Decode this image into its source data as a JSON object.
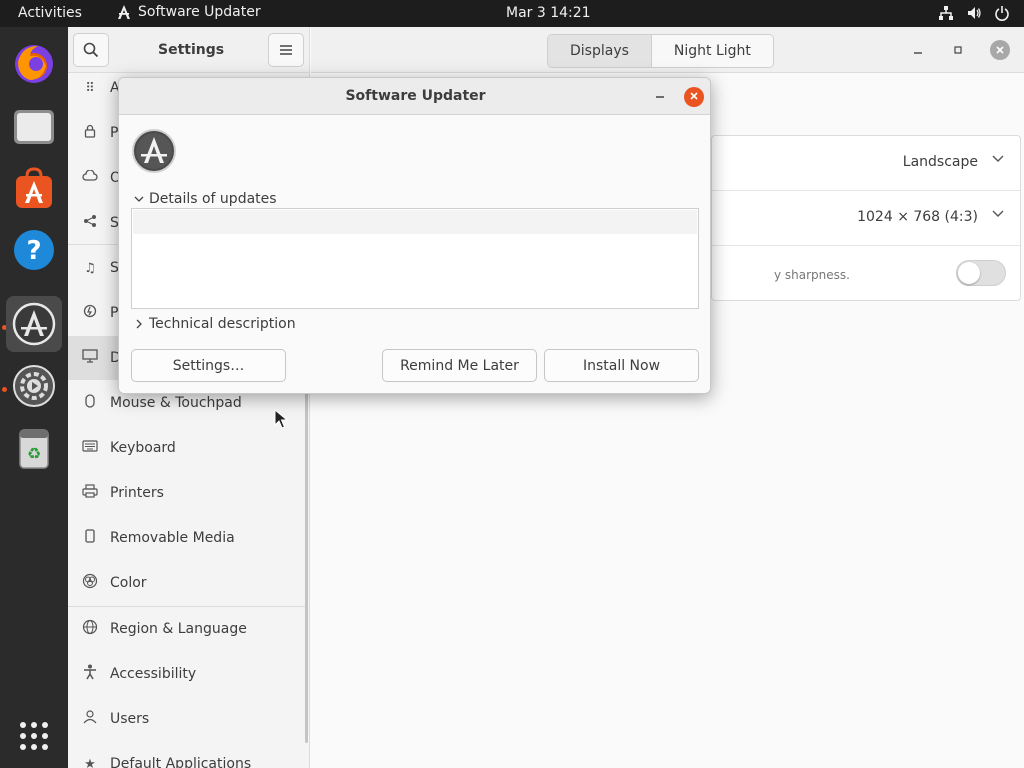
{
  "topbar": {
    "activities": "Activities",
    "app_name": "Software Updater",
    "clock": "Mar 3  14:21"
  },
  "dock": {
    "items": [
      "firefox-icon",
      "files-icon",
      "app-center-icon",
      "help-icon",
      "software-updater-icon",
      "settings-icon",
      "trash-icon",
      "show-apps-icon"
    ]
  },
  "settings": {
    "title": "Settings",
    "tabs": [
      "Displays",
      "Night Light"
    ],
    "active_tab": "Displays",
    "sidebar": [
      {
        "label": "A",
        "icon": "grid-icon"
      },
      {
        "label": "P",
        "icon": "lock-icon"
      },
      {
        "label": "O",
        "icon": "cloud-icon"
      },
      {
        "label": "S",
        "icon": "share-icon"
      },
      {
        "label": "S",
        "icon": "music-icon"
      },
      {
        "label": "P",
        "icon": "power-icon"
      },
      {
        "label": "D",
        "icon": "display-icon"
      },
      {
        "label": "Mouse & Touchpad",
        "icon": "mouse-icon"
      },
      {
        "label": "Keyboard",
        "icon": "keyboard-icon"
      },
      {
        "label": "Printers",
        "icon": "printer-icon"
      },
      {
        "label": "Removable Media",
        "icon": "media-icon"
      },
      {
        "label": "Color",
        "icon": "color-icon"
      },
      {
        "label": "Region & Language",
        "icon": "globe-icon"
      },
      {
        "label": "Accessibility",
        "icon": "accessibility-icon"
      },
      {
        "label": "Users",
        "icon": "user-icon"
      },
      {
        "label": "Default Applications",
        "icon": "star-icon"
      }
    ],
    "display_panel": {
      "orientation": "Landscape",
      "resolution": "1024 × 768 (4:3)",
      "fractional_hint": "y sharpness."
    }
  },
  "dialog": {
    "title": "Software Updater",
    "details_label": "Details of updates",
    "technical_label": "Technical description",
    "settings_button": "Settings…",
    "remind_button": "Remind Me Later",
    "install_button": "Install Now"
  },
  "colors": {
    "accent": "#e95420",
    "topbar": "#1d1d1d",
    "dock": "#2b2b2b"
  }
}
